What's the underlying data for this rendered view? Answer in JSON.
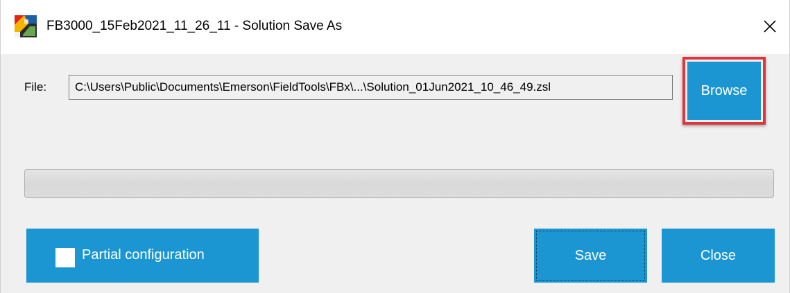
{
  "window": {
    "title": "FB3000_15Feb2021_11_26_11 - Solution Save As",
    "app_icon": "fieldtools-app-icon",
    "close_icon": "close-icon"
  },
  "file": {
    "label": "File:",
    "value": "C:\\Users\\Public\\Documents\\Emerson\\FieldTools\\FBx\\...\\Solution_01Jun2021_10_46_49.zsl"
  },
  "buttons": {
    "browse": "Browse",
    "partial_configuration": "Partial configuration",
    "save": "Save",
    "close": "Close"
  },
  "progress": {
    "value": 0
  },
  "partial_checkbox": {
    "checked": false
  },
  "colors": {
    "accent": "#1c96d2",
    "highlight": "#e0353c",
    "window_bg": "#f0f0f0"
  }
}
